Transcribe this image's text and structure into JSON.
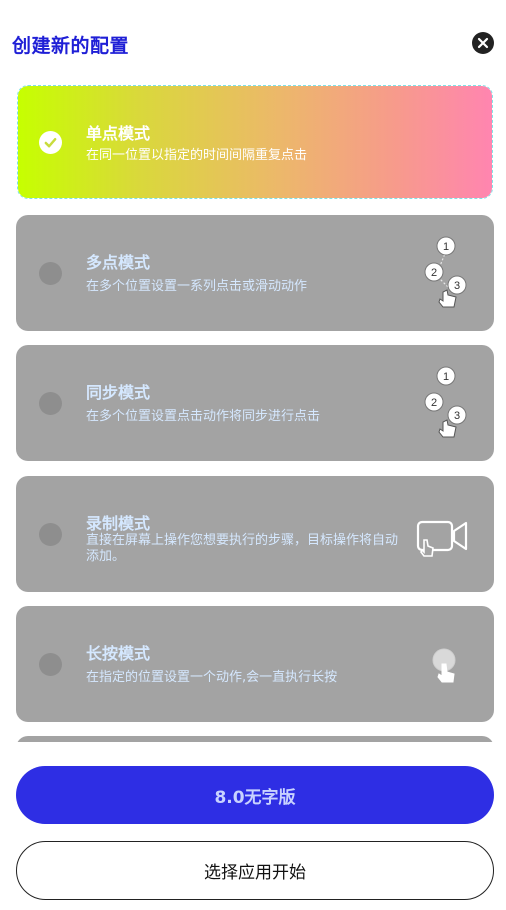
{
  "header": {
    "title": "创建新的配置",
    "close_icon": "close-icon"
  },
  "modes": [
    {
      "title": "单点模式",
      "desc": "在同一位置以指定的时间间隔重复点击",
      "selected": true,
      "icon": "checkmark-icon"
    },
    {
      "title": "多点模式",
      "desc": "在多个位置设置一系列点击或滑动动作",
      "selected": false,
      "icon": "multi-tap-icon",
      "icon_numbers": [
        "1",
        "2",
        "3"
      ]
    },
    {
      "title": "同步模式",
      "desc": "在多个位置设置点击动作将同步进行点击",
      "selected": false,
      "icon": "sync-tap-icon",
      "icon_numbers": [
        "1",
        "2",
        "3"
      ]
    },
    {
      "title": "录制模式",
      "desc": "直接在屏幕上操作您想要执行的步骤，目标操作将自动添加。",
      "selected": false,
      "icon": "record-screen-icon"
    },
    {
      "title": "长按模式",
      "desc": "在指定的位置设置一个动作,会一直执行长按",
      "selected": false,
      "icon": "long-press-icon"
    }
  ],
  "buttons": {
    "primary_label": "8.0无字版",
    "secondary_label": "选择应用开始"
  },
  "colors": {
    "title": "#1f1fd6",
    "card_bg": "#a3a3a3",
    "primary_bg": "#2e2ee4",
    "gradient_start": "#c6ff00",
    "gradient_end": "#ff85b0"
  }
}
